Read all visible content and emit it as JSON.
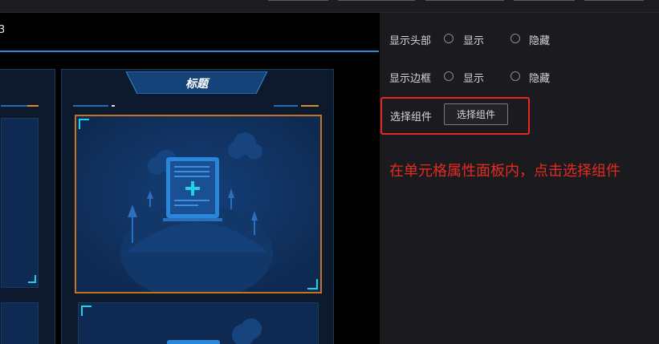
{
  "canvas": {
    "title_fragment": "3",
    "card": {
      "title": "标题"
    }
  },
  "panel": {
    "show_header": {
      "label": "显示头部",
      "options": [
        "显示",
        "隐藏"
      ]
    },
    "show_border": {
      "label": "显示边框",
      "options": [
        "显示",
        "隐藏"
      ]
    },
    "select_component": {
      "label": "选择组件",
      "button": "选择组件"
    },
    "instruction": "在单元格属性面板内，点击选择组件"
  },
  "colors": {
    "canvas_bg": "#000000",
    "panel_bg": "#1b1b1f",
    "accent_blue": "#2f88d8",
    "highlight_red": "#e52b20",
    "selected_orange": "#c27420",
    "corner_cyan": "#1fd0e8"
  }
}
